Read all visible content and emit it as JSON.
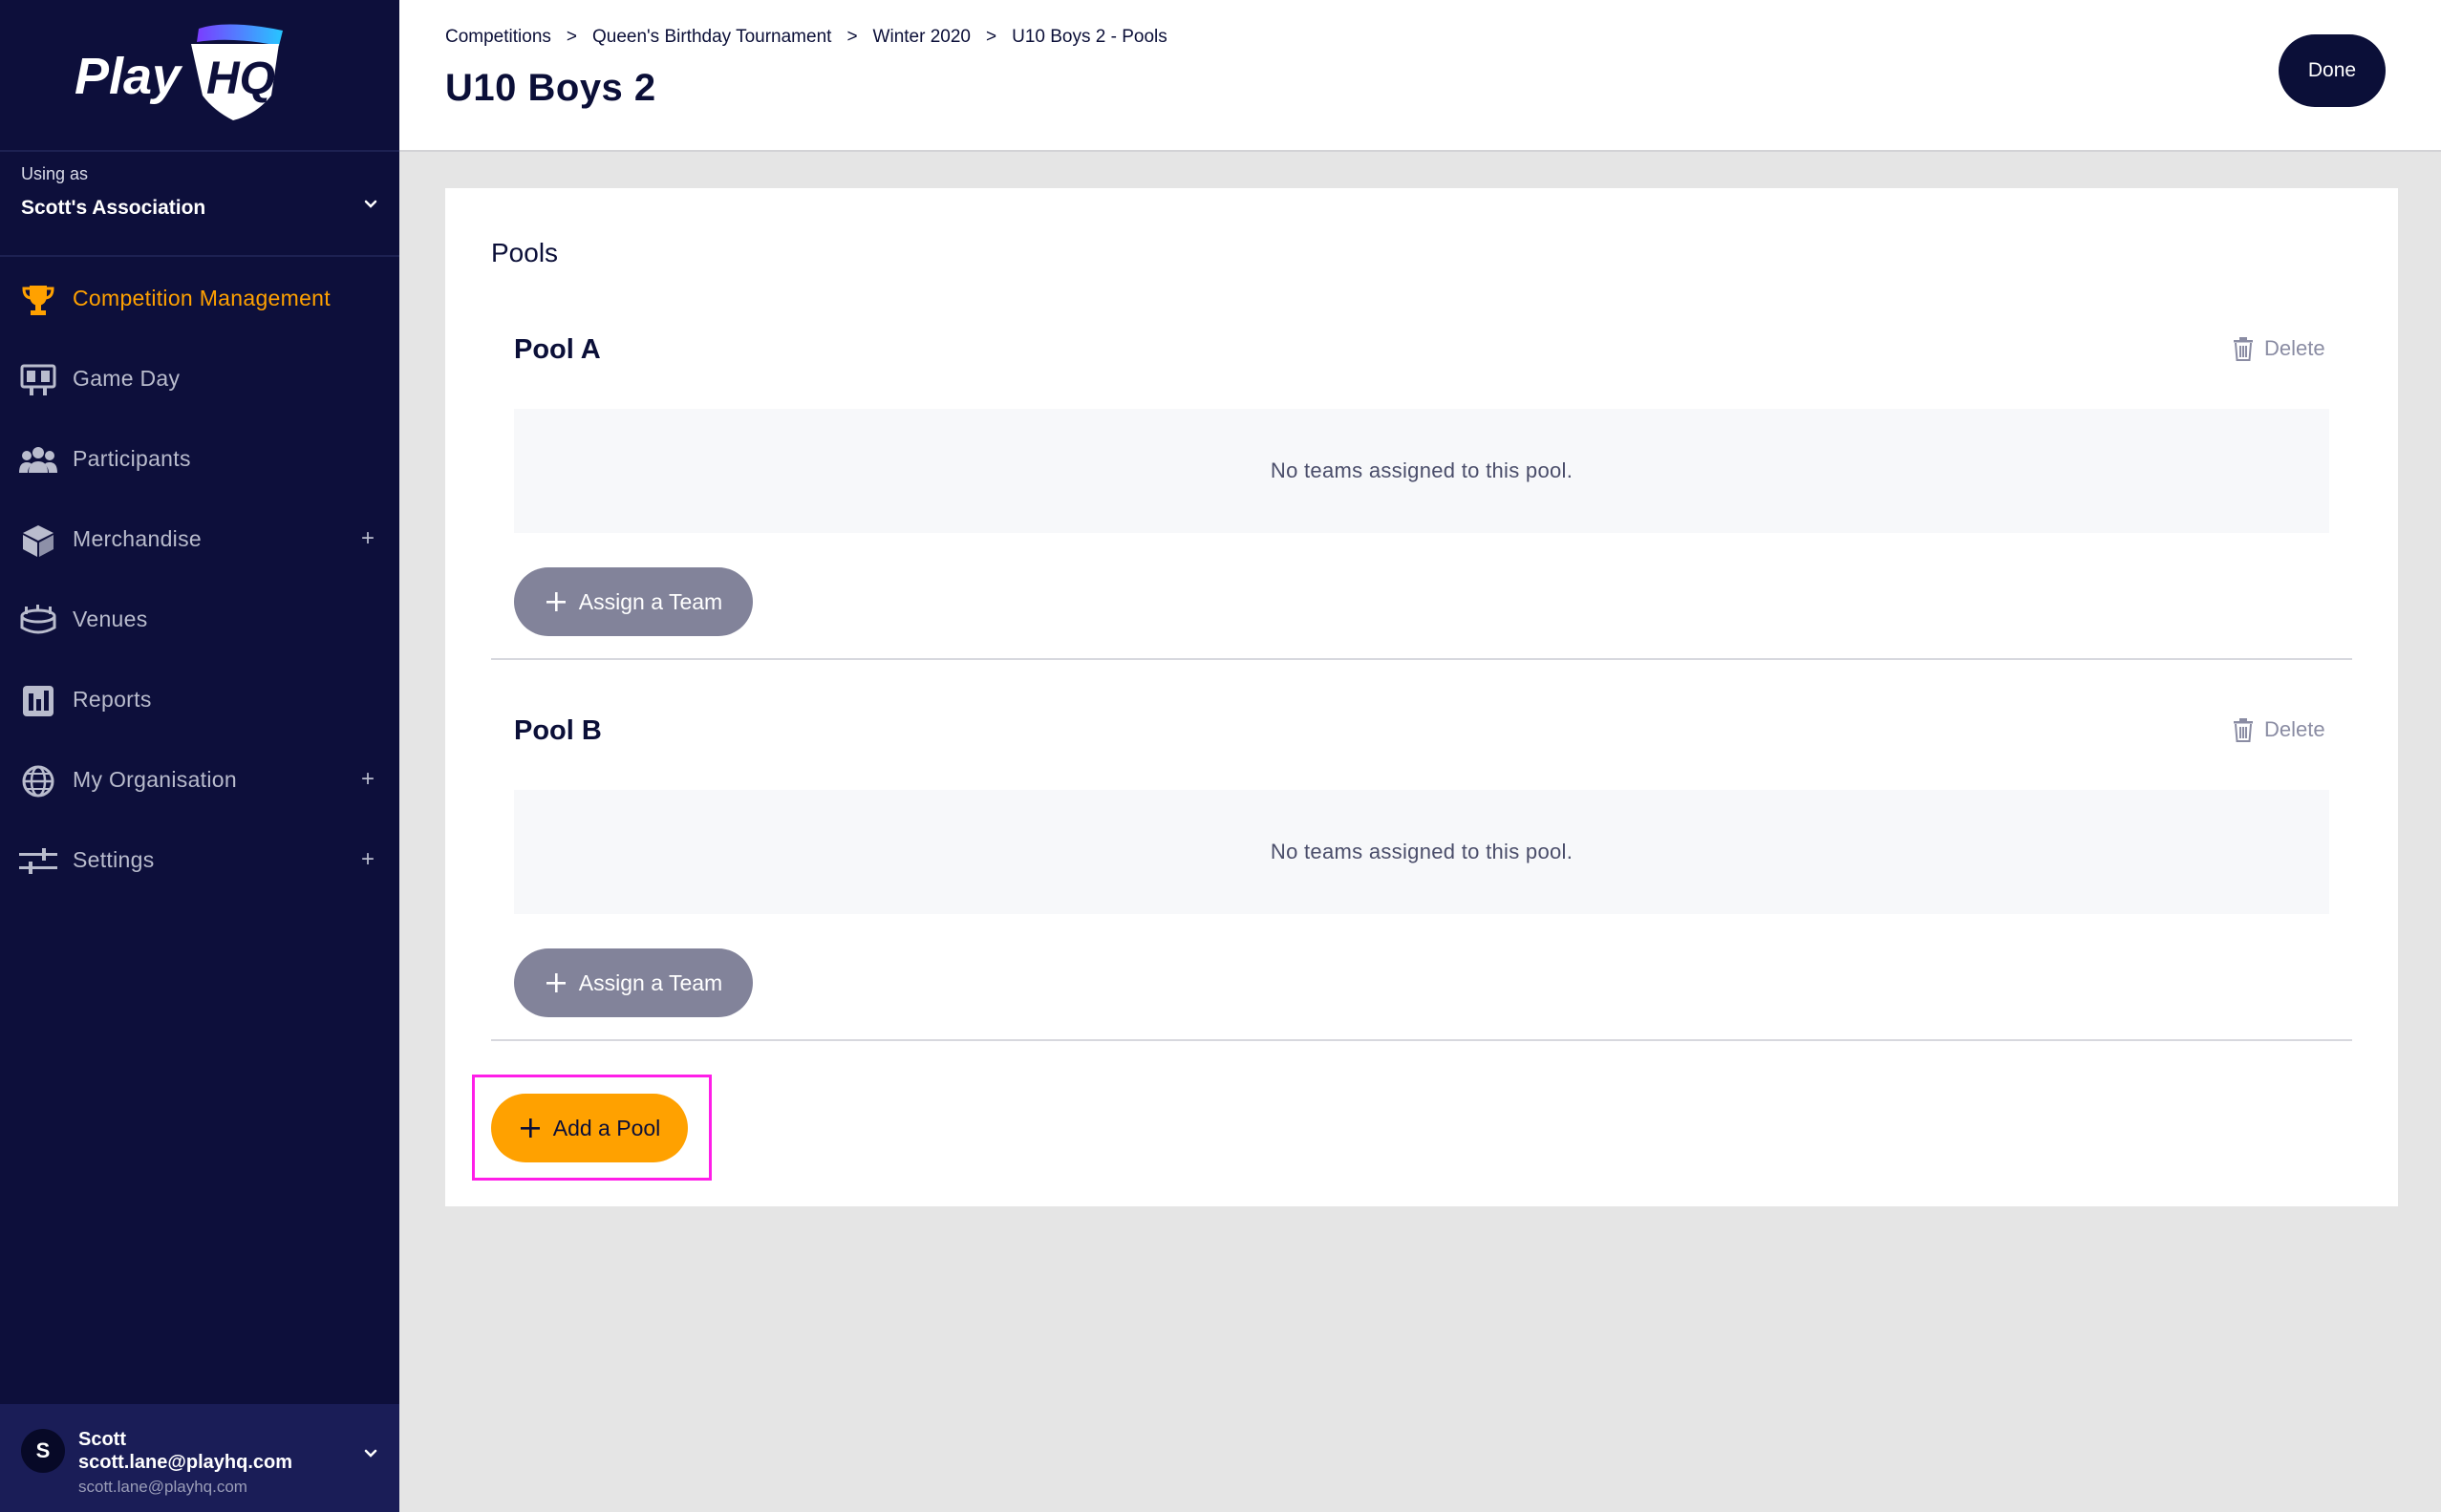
{
  "sidebar": {
    "logo_text": "PlayHQ",
    "using_as_label": "Using as",
    "org_name": "Scott's Association",
    "nav": [
      {
        "label": "Competition Management",
        "icon": "trophy-icon",
        "active": true
      },
      {
        "label": "Game Day",
        "icon": "scoreboard-icon"
      },
      {
        "label": "Participants",
        "icon": "people-icon"
      },
      {
        "label": "Merchandise",
        "icon": "box-icon",
        "expandable": "+"
      },
      {
        "label": "Venues",
        "icon": "stadium-icon"
      },
      {
        "label": "Reports",
        "icon": "bar-chart-icon"
      },
      {
        "label": "My Organisation",
        "icon": "globe-icon",
        "expandable": "+"
      },
      {
        "label": "Settings",
        "icon": "sliders-icon",
        "expandable": "+"
      }
    ],
    "user": {
      "initial": "S",
      "name": "Scott",
      "email_bold": "scott.lane@playhq.com",
      "email": "scott.lane@playhq.com"
    }
  },
  "header": {
    "breadcrumb": [
      "Competitions",
      "Queen's Birthday Tournament",
      "Winter 2020",
      "U10 Boys 2 - Pools"
    ],
    "breadcrumb_sep": ">",
    "title": "U10 Boys 2",
    "done_label": "Done"
  },
  "main": {
    "section_title": "Pools",
    "pools": [
      {
        "name": "Pool A",
        "delete_label": "Delete",
        "empty_text": "No teams assigned to this pool.",
        "assign_label": "Assign a Team"
      },
      {
        "name": "Pool B",
        "delete_label": "Delete",
        "empty_text": "No teams assigned to this pool.",
        "assign_label": "Assign a Team"
      }
    ],
    "add_pool_label": "Add a Pool"
  },
  "colors": {
    "sidebar_bg": "#0d0f3b",
    "accent": "#ffa100",
    "dark": "#0b0f38",
    "assign_btn": "#82839a",
    "highlight": "#ff1ee8"
  }
}
